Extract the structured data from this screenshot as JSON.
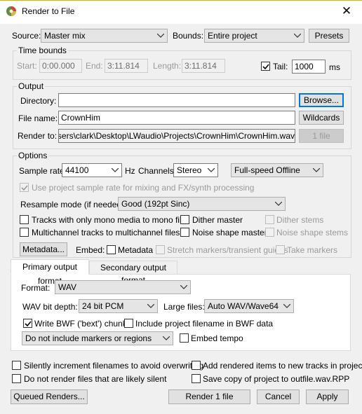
{
  "window": {
    "title": "Render to File",
    "close_glyph": "✕"
  },
  "top": {
    "source_label": "Source:",
    "source_value": "Master mix",
    "bounds_label": "Bounds:",
    "bounds_value": "Entire project",
    "presets_label": "Presets"
  },
  "time_bounds": {
    "group_label": "Time bounds",
    "start_label": "Start:",
    "start_value": "0:00.000",
    "end_label": "End:",
    "end_value": "3:11.814",
    "length_label": "Length:",
    "length_value": "3:11.814",
    "tail_label": "Tail:",
    "tail_checked": true,
    "tail_value": "1000",
    "tail_unit": "ms"
  },
  "output": {
    "group_label": "Output",
    "directory_label": "Directory:",
    "directory_value": "",
    "browse_label": "Browse...",
    "filename_label": "File name:",
    "filename_value": "CrownHim",
    "wildcards_label": "Wildcards",
    "render_to_label": "Render to:",
    "render_to_value": "C:\\Users\\clark\\Desktop\\LWaudio\\Projects\\CrownHim\\CrownHim.wav",
    "files_count_label": "1 file"
  },
  "options": {
    "group_label": "Options",
    "sample_rate_label": "Sample rate:",
    "sample_rate_value": "44100",
    "sample_rate_unit": "Hz",
    "channels_label": "Channels:",
    "channels_value": "Stereo",
    "render_speed_value": "Full-speed Offline",
    "use_project_rate_label": "Use project sample rate for mixing and FX/synth processing",
    "resample_label": "Resample mode (if needed):",
    "resample_value": "Good (192pt Sinc)",
    "mono_tracks_label": "Tracks with only mono media to mono file",
    "dither_master_label": "Dither master",
    "dither_stems_label": "Dither stems",
    "multichannel_label": "Multichannel tracks to multichannel files",
    "noise_master_label": "Noise shape master",
    "noise_stems_label": "Noise shape stems",
    "metadata_button_label": "Metadata...",
    "embed_label": "Embed:",
    "embed_metadata_label": "Metadata",
    "stretch_markers_label": "Stretch markers/transient guides",
    "take_markers_label": "Take markers"
  },
  "tabs": [
    {
      "label": "Primary output format",
      "active": true
    },
    {
      "label": "Secondary output format",
      "active": false
    }
  ],
  "format": {
    "format_label": "Format:",
    "format_value": "WAV",
    "bit_depth_label": "WAV bit depth:",
    "bit_depth_value": "24 bit PCM",
    "large_files_label": "Large files:",
    "large_files_value": "Auto WAV/Wave64",
    "write_bwf_label": "Write BWF ('bext') chunk",
    "write_bwf_checked": true,
    "include_filename_label": "Include project filename in BWF data",
    "markers_value": "Do not include markers or regions",
    "embed_tempo_label": "Embed tempo"
  },
  "bottom": {
    "silent_increment_label": "Silently increment filenames to avoid overwriting",
    "add_rendered_label": "Add rendered items to new tracks in project",
    "skip_silent_label": "Do not render files that are likely silent",
    "save_copy_label": "Save copy of project to outfile.wav.RPP",
    "queued_label": "Queued Renders...",
    "render_label": "Render 1 file",
    "cancel_label": "Cancel",
    "apply_label": "Apply"
  },
  "icons": {
    "app": "reaper-app-icon",
    "close": "close-icon",
    "dropdown": "chevron-down-icon",
    "check": "check-icon"
  },
  "colors": {
    "accent": "#0078d7",
    "title_accent": "#e0b000"
  }
}
